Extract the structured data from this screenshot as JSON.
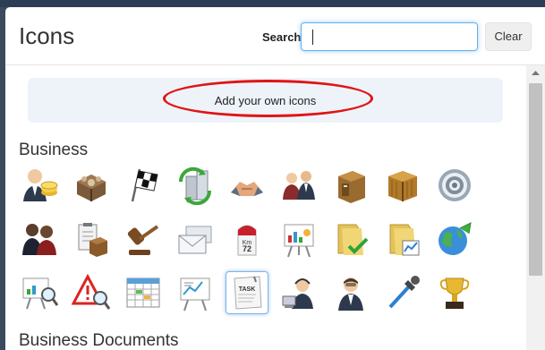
{
  "dialog": {
    "title": "Icons"
  },
  "search": {
    "label": "Search",
    "value": "",
    "clear_label": "Clear"
  },
  "add_icons": {
    "label": "Add your own icons"
  },
  "sections": [
    {
      "title": "Business",
      "rows": [
        [
          "user-money-icon",
          "treasure-chest-icon",
          "checkered-flag-icon",
          "recycle-building-icon",
          "handshake-icon",
          "meeting-icon",
          "cabinet-box-icon",
          "wooden-crate-icon",
          "target-icon"
        ],
        [
          "businessmen-pair-icon",
          "clipboard-box-icon",
          "gavel-icon",
          "envelopes-icon",
          "km-signpost-icon",
          "presentation-board-icon",
          "folder-check-icon",
          "folder-chart-icon",
          "globe-arrow-icon"
        ],
        [
          "presentation-search-icon",
          "warning-search-icon",
          "calendar-grid-icon",
          "whiteboard-chart-icon",
          "task-note-icon",
          "support-agent-icon",
          "businessman-icon",
          "pipette-icon",
          "trophy-icon"
        ]
      ],
      "selected_icon": "task-note-icon",
      "task_note_text": "TASK",
      "signpost_text": "Km 72"
    },
    {
      "title": "Business Documents"
    }
  ],
  "colors": {
    "accent": "#66afe9",
    "highlight": "#e01414",
    "panel": "#eef3fa"
  }
}
